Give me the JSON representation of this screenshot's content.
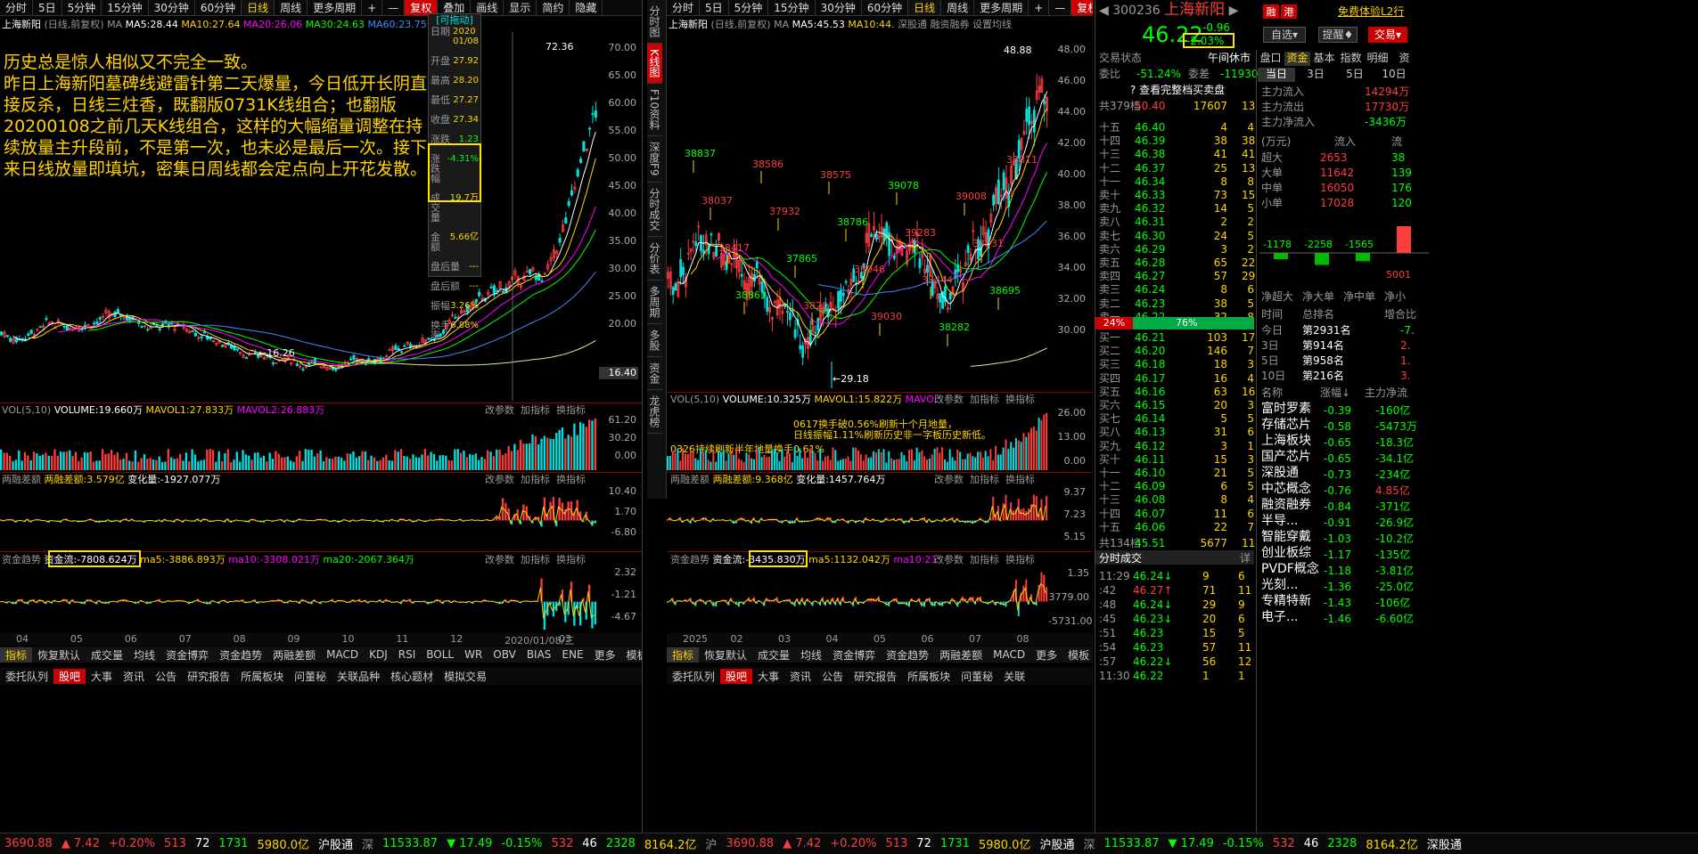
{
  "left_toolbar": [
    "分时",
    "5日",
    "5分钟",
    "15分钟",
    "30分钟",
    "60分钟",
    "日线",
    "周线",
    "更多周期",
    "+",
    "—",
    "复权",
    "叠加",
    "画线",
    "显示",
    "简约",
    "隐藏"
  ],
  "left_chart": {
    "title": "上海新阳",
    "title_sub": "(日线,前复权)",
    "ma_lbl": "MA",
    "ma5": "MA5:28.44",
    "ma10": "MA10:27.64",
    "ma20": "MA20:26.06",
    "ma30": "MA30:24.63",
    "ma60": "MA60:23.75",
    "yticks": [
      "70.00",
      "65.00",
      "60.00",
      "55.00",
      "50.00",
      "45.00",
      "40.00",
      "35.00",
      "30.00",
      "25.00",
      "20.00"
    ],
    "hi_label": "72.36",
    "lo_label": "16.26",
    "cur_price": "16.40",
    "annotation": "历史总是惊人相似又不完全一致。\n昨日上海新阳墓碑线避雷针第二天爆量，今日低开长阴直接反杀，日线三炷香，既翻版0731K线组合；也翻版20200108之前几天K线组合，这样的大幅缩量调整在持续放量主升段前，不是第一次，也未必是最后一次。接下来日线放量即填坑，密集日周线都会定点向上开花发散。",
    "popup": {
      "header": "[可拖动]",
      "rows": [
        [
          "日期",
          "2020\n01/08"
        ],
        [
          "开盘",
          "27.92"
        ],
        [
          "最高",
          "28.20"
        ],
        [
          "最低",
          "27.27"
        ],
        [
          "收盘",
          "27.34"
        ],
        [
          "涨跌",
          "1.23"
        ],
        [
          "涨跌幅",
          "-4.31%"
        ],
        [
          "成交量",
          "19.7万"
        ],
        [
          "金额",
          "5.66亿"
        ],
        [
          "盘后量",
          "---"
        ],
        [
          "盘后额",
          "---"
        ],
        [
          "振幅",
          "3.26%"
        ],
        [
          "换手率",
          "6.88%"
        ]
      ]
    },
    "vol_title": "VOL(5,10)",
    "vol_val": "VOLUME:19.660万",
    "vol_m1": "MAVOL1:27.833万",
    "vol_m2": "MAVOL2:26.883万",
    "vol_ticks": [
      "61.20",
      "30.20",
      "0.00"
    ],
    "rz_title": "两融差额",
    "rz_val": "两融差额:3.579亿",
    "rz_chg": "变化量:-1927.077万",
    "rz_ticks": [
      "10.40",
      "1.70",
      "-6.80"
    ],
    "zj_title": "资金趋势",
    "zj_val": "资金流:-7808.624万",
    "zj_m5": "ma5:-3886.893万",
    "zj_m10": "ma10:-3308.021万",
    "zj_m20": "ma20:-2067.364万",
    "zj_ticks": [
      "2.32",
      "-1.21",
      "-4.67"
    ],
    "ops": [
      "改参数",
      "加指标",
      "换指标"
    ],
    "xaxis": [
      "04",
      "05",
      "06",
      "07",
      "08",
      "09",
      "10",
      "11",
      "12",
      "2020/01/08/三",
      "03"
    ],
    "tabs": [
      "指标",
      "恢复默认",
      "成交量",
      "均线",
      "资金博弈",
      "资金趋势",
      "两融差额",
      "MACD",
      "KDJ",
      "RSI",
      "BOLL",
      "WR",
      "OBV",
      "BIAS",
      "ENE",
      "更多",
      "模板"
    ],
    "btabs": [
      "委托队列",
      "股吧",
      "大事",
      "资讯",
      "公告",
      "研究报告",
      "所属板块",
      "问董秘",
      "关联品种",
      "核心题材",
      "模拟交易"
    ]
  },
  "side_tabs": [
    "分时图",
    "K线图",
    "F10资料",
    "深度F9",
    "分时成交",
    "分价表",
    "多周期",
    "多股",
    "资金",
    "龙虎榜"
  ],
  "mid_toolbar": [
    "分时",
    "5日",
    "5分钟",
    "15分钟",
    "30分钟",
    "60分钟",
    "日线",
    "周线",
    "更多周期",
    "+",
    "—",
    "复权",
    "叠加",
    "画线",
    "显示",
    "简约",
    "隐藏"
  ],
  "mid_chart": {
    "title": "上海新阳",
    "title_sub": "(日线,前复权)",
    "ma": "MA",
    "ma5": "MA5:45.53",
    "ma10": "MA10:44.",
    "other": "深股通",
    "rz": "融资融券",
    "set": "设置均线",
    "yticks": [
      "48.00",
      "46.00",
      "44.00",
      "42.00",
      "40.00",
      "38.00",
      "36.00",
      "34.00",
      "32.00",
      "30.00"
    ],
    "hi": "48.88",
    "lo": "29.18",
    "marks": [
      "38837",
      "38037",
      "38417",
      "38861",
      "38586",
      "37932",
      "37865",
      "38201",
      "38575",
      "38786",
      "38046",
      "39030",
      "39078",
      "39283",
      "38344",
      "38282",
      "39008",
      "38631",
      "38695",
      "38811"
    ],
    "vol_title": "VOL(5,10)",
    "vol_val": "VOLUME:10.325万",
    "vol_m1": "MAVOL1:15.822万",
    "vol_m2": "MAVOL2:12.",
    "vol_ticks": [
      "26.00",
      "13.00",
      "0.00"
    ],
    "vol_note1": "0617换手破0.56%刷新十个月地量，",
    "vol_note2": "日线振幅1.11%刷新历史非一字板历史新低。",
    "vol_note3": "0326持续刷新半年地量换手0.61%",
    "rz_title": "两融差额",
    "rz_val": "两融差额:9.368亿",
    "rz_chg": "变化量:1457.764万",
    "rz_ticks": [
      "9.37",
      "7.23",
      "5.15"
    ],
    "zj_title": "资金趋势",
    "zj_val": "资金流:-3435.830万",
    "zj_m5": "ma5:1132.042万",
    "zj_m10": "ma10:2136",
    "zj_ticks": [
      "1.35",
      "3779.00",
      "-5731.00"
    ],
    "xaxis": [
      "2025",
      "02",
      "03",
      "04",
      "05",
      "06",
      "07",
      "08"
    ],
    "tabs": [
      "指标",
      "恢复默认",
      "成交量",
      "均线",
      "资金博弈",
      "资金趋势",
      "两融差额",
      "MACD",
      "更多",
      "模板"
    ],
    "btabs": [
      "委托队列",
      "股吧",
      "大事",
      "资讯",
      "公告",
      "研究报告",
      "所属板块",
      "问董秘",
      "关联"
    ]
  },
  "quote": {
    "code": "300236",
    "name": "上海新阳",
    "tag1": "融",
    "tag2": "港",
    "free": "免费体验L2行",
    "price": "46.22",
    "chg": "-0.96",
    "pct": "-2.03%",
    "sel": "自选",
    "remind": "提醒",
    "trade": "交易",
    "state_lbl": "交易状态",
    "state": "午间休市",
    "wb_lbl": "委比",
    "wb": "-51.24%",
    "wc_lbl": "委差",
    "wc": "-11930",
    "full": "查看完整档买卖盘",
    "sum_sell": [
      "共379档",
      "50.40",
      "17607",
      "13"
    ],
    "asks": [
      [
        "十五",
        "46.40",
        "4",
        "4"
      ],
      [
        "十四",
        "46.39",
        "38",
        "38"
      ],
      [
        "十三",
        "46.38",
        "41",
        "41"
      ],
      [
        "十二",
        "46.37",
        "25",
        "13"
      ],
      [
        "十一",
        "46.34",
        "8",
        "8"
      ],
      [
        "卖十",
        "46.33",
        "73",
        "15"
      ],
      [
        "卖九",
        "46.32",
        "14",
        "5"
      ],
      [
        "卖八",
        "46.31",
        "2",
        "2"
      ],
      [
        "卖七",
        "46.30",
        "24",
        "5"
      ],
      [
        "卖六",
        "46.29",
        "3",
        "2"
      ],
      [
        "卖五",
        "46.28",
        "65",
        "22"
      ],
      [
        "卖四",
        "46.27",
        "57",
        "29"
      ],
      [
        "卖三",
        "46.24",
        "8",
        "6"
      ],
      [
        "卖二",
        "46.23",
        "38",
        "5"
      ],
      [
        "卖一",
        "46.22",
        "32",
        "8"
      ]
    ],
    "ratio_l": "24%",
    "ratio_r": "76%",
    "bids": [
      [
        "买一",
        "46.21",
        "103",
        "17"
      ],
      [
        "买二",
        "46.20",
        "146",
        "7"
      ],
      [
        "买三",
        "46.18",
        "18",
        "3"
      ],
      [
        "买四",
        "46.17",
        "16",
        "4"
      ],
      [
        "买五",
        "46.16",
        "63",
        "16"
      ],
      [
        "买六",
        "46.15",
        "20",
        "3"
      ],
      [
        "买七",
        "46.14",
        "5",
        "5"
      ],
      [
        "买八",
        "46.13",
        "31",
        "6"
      ],
      [
        "买九",
        "46.12",
        "3",
        "1"
      ],
      [
        "买十",
        "46.11",
        "15",
        "3"
      ],
      [
        "十一",
        "46.10",
        "21",
        "5"
      ],
      [
        "十二",
        "46.09",
        "6",
        "5"
      ],
      [
        "十三",
        "46.08",
        "8",
        "4"
      ],
      [
        "十四",
        "46.07",
        "11",
        "6"
      ],
      [
        "十五",
        "46.06",
        "22",
        "7"
      ]
    ],
    "sum_buy": [
      "共134档",
      "45.51",
      "5677",
      "11"
    ],
    "ticks_title": "分时成交",
    "ticks_more": "详",
    "ticks": [
      [
        "11:29",
        "46.24↓",
        "9",
        "6"
      ],
      [
        ":42",
        "46.27↑",
        "71",
        "11"
      ],
      [
        ":48",
        "46.24↓",
        "29",
        "9"
      ],
      [
        ":45",
        "46.23↓",
        "20",
        "6"
      ],
      [
        ":51",
        "46.23",
        "15",
        "5"
      ],
      [
        ":54",
        "46.23",
        "57",
        "11"
      ],
      [
        ":57",
        "46.22↓",
        "56",
        "12"
      ],
      [
        "11:30",
        "46.22",
        "1",
        "1"
      ]
    ]
  },
  "fund": {
    "tabs": [
      "盘口",
      "资金",
      "基本",
      "指数",
      "明细",
      "资"
    ],
    "periods": [
      "当日",
      "3日",
      "5日",
      "10日"
    ],
    "rows": [
      [
        "主力流入",
        "14294万"
      ],
      [
        "主力流出",
        "17730万"
      ],
      [
        "主力净流入",
        "-3436万"
      ]
    ],
    "unit": "(万元)",
    "col_in": "流入",
    "col_out": "流",
    "cats": [
      [
        "超大",
        "2653",
        "38"
      ],
      [
        "大单",
        "11642",
        "139"
      ],
      [
        "中单",
        "16050",
        "176"
      ],
      [
        "小单",
        "17028",
        "120"
      ]
    ],
    "bars": [
      "-1178",
      "-2258",
      "-1565",
      "5001"
    ],
    "bar_lbls": [
      "净超大",
      "净大单",
      "净中单",
      "净小"
    ],
    "rank_hdr": [
      "时间",
      "总排名",
      "增合比"
    ],
    "ranks": [
      [
        "今日",
        "第2931名",
        "-7."
      ],
      [
        "3日",
        "第914名",
        "2."
      ],
      [
        "5日",
        "第958名",
        "1."
      ],
      [
        "10日",
        "第216名",
        "3."
      ]
    ],
    "sect_hdr": [
      "名称",
      "涨幅↓",
      "主力净流"
    ],
    "sects": [
      [
        "富时罗素",
        "-0.39",
        "-160亿"
      ],
      [
        "存储芯片",
        "-0.58",
        "-5473万"
      ],
      [
        "上海板块",
        "-0.65",
        "-18.3亿"
      ],
      [
        "国产芯片",
        "-0.65",
        "-34.1亿"
      ],
      [
        "深股通",
        "-0.73",
        "-234亿"
      ],
      [
        "中芯概念",
        "-0.76",
        "4.85亿"
      ],
      [
        "融资融券",
        "-0.84",
        "-371亿"
      ],
      [
        "半导...",
        "-0.91",
        "-26.9亿"
      ],
      [
        "智能穿戴",
        "-1.03",
        "-10.2亿"
      ],
      [
        "创业板综",
        "-1.17",
        "-135亿"
      ],
      [
        "PVDF概念",
        "-1.18",
        "-3.81亿"
      ],
      [
        "光刻...",
        "-1.36",
        "-25.0亿"
      ],
      [
        "专精特新",
        "-1.43",
        "-106亿"
      ],
      [
        "电子...",
        "-1.46",
        "-6.60亿"
      ]
    ]
  },
  "status": {
    "sh": "3690.88",
    "shc": "▲ 7.42",
    "shp": "+0.20%",
    "u": "513",
    "f": "72",
    "d": "1731",
    "amt": "5980.0亿",
    "hg": "沪股通",
    "sz": "深",
    "szv": "11533.87",
    "szc": "▼ 17.49",
    "szp": "-0.15%",
    "su": "532",
    "sf": "46",
    "sd": "2328",
    "samt": "8164.2亿",
    "sg": "沪",
    "sh2": "3690.88",
    "shc2": "▲ 7.42",
    "shp2": "+0.20%",
    "u2": "513",
    "f2": "72",
    "d2": "1731",
    "amt2": "5980.0亿",
    "hg2": "沪股通",
    "sz2": "深",
    "szv2": "11533.87",
    "szc2": "▼ 17.49",
    "szp2": "-0.15%",
    "su2": "532",
    "sf2": "46",
    "sd2": "2328",
    "samt2": "8164.2亿",
    "sg2": "深股通"
  },
  "colors": {
    "up": "#ff3c3c",
    "down": "#00e0e0",
    "ma5": "#ffffff",
    "ma10": "#ffd400",
    "ma20": "#ff00ff",
    "ma30": "#00ff00",
    "ma60": "#4488ff",
    "box": "#ffe400"
  }
}
